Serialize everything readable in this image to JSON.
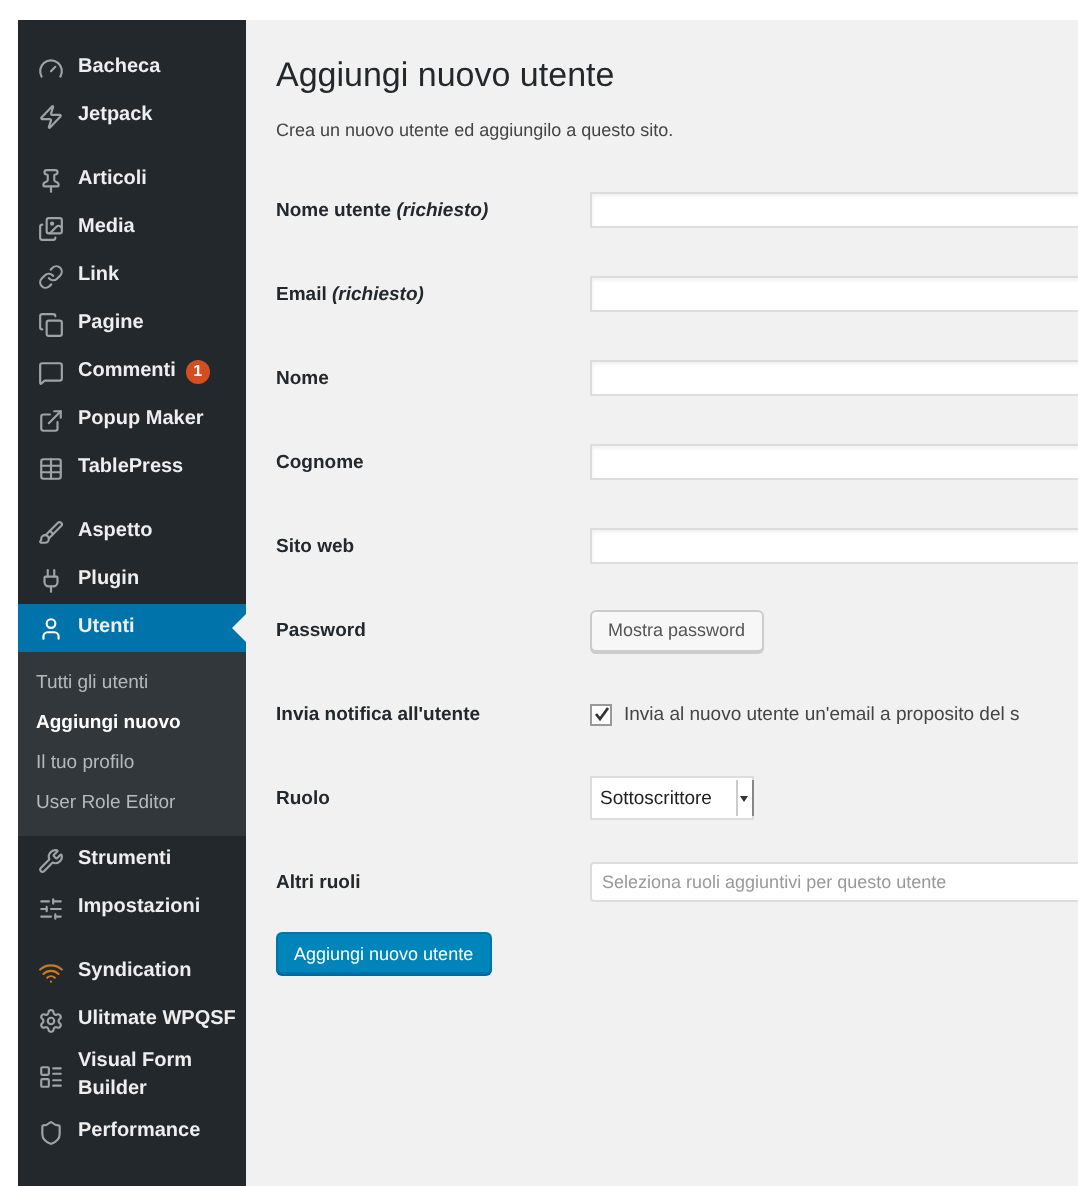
{
  "sidebar": {
    "groups": [
      {
        "items": [
          {
            "label": "Bacheca",
            "selected": false
          },
          {
            "label": "Jetpack",
            "selected": false
          }
        ]
      },
      {
        "items": [
          {
            "label": "Articoli",
            "selected": false
          },
          {
            "label": "Media",
            "selected": false
          },
          {
            "label": "Link",
            "selected": false
          },
          {
            "label": "Pagine",
            "selected": false
          },
          {
            "label": "Commenti",
            "selected": false,
            "badge": "1"
          },
          {
            "label": "Popup Maker",
            "selected": false
          },
          {
            "label": "TablePress",
            "selected": false
          }
        ]
      },
      {
        "items": [
          {
            "label": "Aspetto",
            "selected": false
          },
          {
            "label": "Plugin",
            "selected": false
          },
          {
            "label": "Utenti",
            "selected": true,
            "children": [
              {
                "label": "Tutti gli utenti",
                "selected": false
              },
              {
                "label": "Aggiungi nuovo",
                "selected": true
              },
              {
                "label": "Il tuo profilo",
                "selected": false
              },
              {
                "label": "User Role Editor",
                "selected": false
              }
            ]
          },
          {
            "label": "Strumenti",
            "selected": false
          },
          {
            "label": "Impostazioni",
            "selected": false
          }
        ]
      },
      {
        "items": [
          {
            "label": "Syndication",
            "selected": false
          },
          {
            "label": "Ulitmate WPQSF",
            "selected": false
          },
          {
            "label": "Visual Form Builder",
            "selected": false
          },
          {
            "label": "Performance",
            "selected": false
          }
        ]
      }
    ]
  },
  "page": {
    "title": "Aggiungi nuovo utente",
    "description": "Crea un nuovo utente ed aggiungilo a questo sito."
  },
  "fields": [
    {
      "kind": "text",
      "label": "Nome utente *(richiesto)*"
    },
    {
      "kind": "text",
      "label": "Email *(richiesto)*"
    },
    {
      "kind": "text",
      "label": "Nome"
    },
    {
      "kind": "text",
      "label": "Cognome"
    },
    {
      "kind": "text",
      "label": "Sito web"
    },
    {
      "kind": "button",
      "label": "Password",
      "button": "Mostra password"
    },
    {
      "kind": "checkbox",
      "label": "Invia notifica all'utente",
      "text": "Invia al nuovo utente un'email a proposito del s",
      "checked": true
    },
    {
      "kind": "select",
      "label": "Ruolo",
      "value": "Sottoscrittore"
    },
    {
      "kind": "multiselect",
      "label": "Altri ruoli",
      "placeholder": "Seleziona ruoli aggiuntivi per questo utente"
    }
  ],
  "submit": "Aggiungi nuovo utente"
}
